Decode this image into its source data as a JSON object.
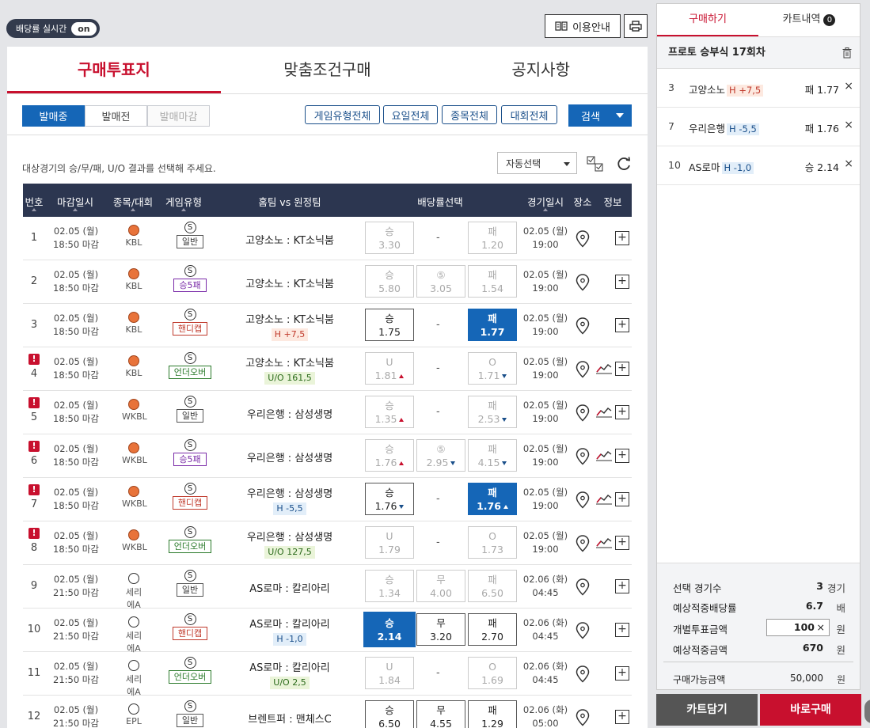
{
  "top": {
    "live_label": "배당률 실시간",
    "live_state": "on",
    "guide_label": "이용안내"
  },
  "tabs": [
    "구매투표지",
    "맞춤조건구매",
    "공지사항"
  ],
  "status_tabs": [
    "발매중",
    "발매전",
    "발매마감"
  ],
  "filters": [
    "게임유형전체",
    "요일전체",
    "종목전체",
    "대회전체"
  ],
  "search_label": "검색",
  "instruction": "대상경기의 승/무/패, U/O 결과를 선택해 주세요.",
  "auto_select": "자동선택",
  "columns": [
    "번호",
    "마감일시",
    "종목/대회",
    "게임유형",
    "홈팀 vs 원정팀",
    "배당률선택",
    "경기일시",
    "장소",
    "정보"
  ],
  "rows": [
    {
      "num": "1",
      "warn": false,
      "date": "02.05 (월)",
      "close": "18:50 마감",
      "league": "KBL",
      "ball": "bball",
      "gtype": "일반",
      "gclass": "t-gen",
      "match": "고양소노 : KT소닉붐",
      "sub": "",
      "subclass": "",
      "odds": [
        {
          "label": "승",
          "value": "3.30",
          "state": ""
        },
        null,
        {
          "label": "패",
          "value": "1.20",
          "state": ""
        }
      ],
      "gdate": "02.05 (월)",
      "gtime": "19:00",
      "chart": false
    },
    {
      "num": "2",
      "warn": false,
      "date": "02.05 (월)",
      "close": "18:50 마감",
      "league": "KBL",
      "ball": "bball",
      "gtype": "승5패",
      "gclass": "t-s5",
      "match": "고양소노 : KT소닉붐",
      "sub": "",
      "subclass": "",
      "odds": [
        {
          "label": "승",
          "value": "5.80",
          "state": ""
        },
        {
          "label": "⑤",
          "value": "3.05",
          "state": ""
        },
        {
          "label": "패",
          "value": "1.54",
          "state": ""
        }
      ],
      "gdate": "02.05 (월)",
      "gtime": "19:00",
      "chart": false
    },
    {
      "num": "3",
      "warn": false,
      "date": "02.05 (월)",
      "close": "18:50 마감",
      "league": "KBL",
      "ball": "bball",
      "gtype": "핸디캡",
      "gclass": "t-hc",
      "match": "고양소노 : KT소닉붐",
      "sub": "H +7,5",
      "subclass": "hp",
      "odds": [
        {
          "label": "승",
          "value": "1.75",
          "state": "act"
        },
        null,
        {
          "label": "패",
          "value": "1.77",
          "state": "sel"
        }
      ],
      "gdate": "02.05 (월)",
      "gtime": "19:00",
      "chart": false
    },
    {
      "num": "4",
      "warn": true,
      "date": "02.05 (월)",
      "close": "18:50 마감",
      "league": "KBL",
      "ball": "bball",
      "gtype": "언더오버",
      "gclass": "t-uo",
      "match": "고양소노 : KT소닉붐",
      "sub": "U/O 161,5",
      "subclass": "uo",
      "odds": [
        {
          "label": "U",
          "value": "1.81",
          "state": "",
          "trend": "up"
        },
        null,
        {
          "label": "O",
          "value": "1.71",
          "state": "",
          "trend": "dn"
        }
      ],
      "gdate": "02.05 (월)",
      "gtime": "19:00",
      "chart": true
    },
    {
      "num": "5",
      "warn": true,
      "date": "02.05 (월)",
      "close": "18:50 마감",
      "league": "WKBL",
      "ball": "bball",
      "gtype": "일반",
      "gclass": "t-gen",
      "match": "우리은행 : 삼성생명",
      "sub": "",
      "subclass": "",
      "odds": [
        {
          "label": "승",
          "value": "1.35",
          "state": "",
          "trend": "up"
        },
        null,
        {
          "label": "패",
          "value": "2.53",
          "state": "",
          "trend": "dn"
        }
      ],
      "gdate": "02.05 (월)",
      "gtime": "19:00",
      "chart": true
    },
    {
      "num": "6",
      "warn": true,
      "date": "02.05 (월)",
      "close": "18:50 마감",
      "league": "WKBL",
      "ball": "bball",
      "gtype": "승5패",
      "gclass": "t-s5",
      "match": "우리은행 : 삼성생명",
      "sub": "",
      "subclass": "",
      "odds": [
        {
          "label": "승",
          "value": "1.76",
          "state": "",
          "trend": "up"
        },
        {
          "label": "⑤",
          "value": "2.95",
          "state": "",
          "trend": "dn"
        },
        {
          "label": "패",
          "value": "4.15",
          "state": "",
          "trend": "dn"
        }
      ],
      "gdate": "02.05 (월)",
      "gtime": "19:00",
      "chart": true
    },
    {
      "num": "7",
      "warn": true,
      "date": "02.05 (월)",
      "close": "18:50 마감",
      "league": "WKBL",
      "ball": "bball",
      "gtype": "핸디캡",
      "gclass": "t-hc",
      "match": "우리은행 : 삼성생명",
      "sub": "H -5,5",
      "subclass": "hm",
      "odds": [
        {
          "label": "승",
          "value": "1.76",
          "state": "act",
          "trend": "dn"
        },
        null,
        {
          "label": "패",
          "value": "1.76",
          "state": "sel",
          "trend": "up"
        }
      ],
      "gdate": "02.05 (월)",
      "gtime": "19:00",
      "chart": true
    },
    {
      "num": "8",
      "warn": true,
      "date": "02.05 (월)",
      "close": "18:50 마감",
      "league": "WKBL",
      "ball": "bball",
      "gtype": "언더오버",
      "gclass": "t-uo",
      "match": "우리은행 : 삼성생명",
      "sub": "U/O 127,5",
      "subclass": "uo",
      "odds": [
        {
          "label": "U",
          "value": "1.79",
          "state": ""
        },
        null,
        {
          "label": "O",
          "value": "1.73",
          "state": ""
        }
      ],
      "gdate": "02.05 (월)",
      "gtime": "19:00",
      "chart": true
    },
    {
      "num": "9",
      "warn": false,
      "date": "02.05 (월)",
      "close": "21:50 마감",
      "league": "세리에A",
      "ball": "sball",
      "gtype": "일반",
      "gclass": "t-gen",
      "match": "AS로마 : 칼리아리",
      "sub": "",
      "subclass": "",
      "odds": [
        {
          "label": "승",
          "value": "1.34",
          "state": ""
        },
        {
          "label": "무",
          "value": "4.00",
          "state": ""
        },
        {
          "label": "패",
          "value": "6.50",
          "state": ""
        }
      ],
      "gdate": "02.06 (화)",
      "gtime": "04:45",
      "chart": false
    },
    {
      "num": "10",
      "warn": false,
      "date": "02.05 (월)",
      "close": "21:50 마감",
      "league": "세리에A",
      "ball": "sball",
      "gtype": "핸디캡",
      "gclass": "t-hc",
      "match": "AS로마 : 칼리아리",
      "sub": "H -1,0",
      "subclass": "hm",
      "odds": [
        {
          "label": "승",
          "value": "2.14",
          "state": "sel selb"
        },
        {
          "label": "무",
          "value": "3.20",
          "state": "act"
        },
        {
          "label": "패",
          "value": "2.70",
          "state": "act"
        }
      ],
      "gdate": "02.06 (화)",
      "gtime": "04:45",
      "chart": false
    },
    {
      "num": "11",
      "warn": false,
      "date": "02.05 (월)",
      "close": "21:50 마감",
      "league": "세리에A",
      "ball": "sball",
      "gtype": "언더오버",
      "gclass": "t-uo",
      "match": "AS로마 : 칼리아리",
      "sub": "U/O 2,5",
      "subclass": "uo",
      "odds": [
        {
          "label": "U",
          "value": "1.84",
          "state": ""
        },
        null,
        {
          "label": "O",
          "value": "1.69",
          "state": ""
        }
      ],
      "gdate": "02.06 (화)",
      "gtime": "04:45",
      "chart": false
    },
    {
      "num": "12",
      "warn": false,
      "date": "02.05 (월)",
      "close": "21:50 마감",
      "league": "EPL",
      "ball": "sball",
      "gtype": "일반",
      "gclass": "t-gen",
      "match": "브렌트퍼 : 맨체스C",
      "sub": "",
      "subclass": "",
      "odds": [
        {
          "label": "승",
          "value": "6.50",
          "state": "act"
        },
        {
          "label": "무",
          "value": "4.55",
          "state": "act"
        },
        {
          "label": "패",
          "value": "1.29",
          "state": "act"
        }
      ],
      "gdate": "02.06 (화)",
      "gtime": "05:00",
      "chart": false
    }
  ],
  "side": {
    "tabs": [
      "구매하기",
      "카트내역"
    ],
    "cart_count": "0",
    "title": "프로토 승부식 17회차",
    "picks": [
      {
        "num": "3",
        "team": "고양소노",
        "hc": "H +7,5",
        "hcclass": "hp",
        "odds": "패 1.77"
      },
      {
        "num": "7",
        "team": "우리은행",
        "hc": "H -5,5",
        "hcclass": "hm",
        "odds": "패 1.76"
      },
      {
        "num": "10",
        "team": "AS로마",
        "hc": "H -1,0",
        "hcclass": "hm",
        "odds": "승 2.14"
      }
    ],
    "summary": {
      "games_label": "선택 경기수",
      "games": "3",
      "games_unit": "경기",
      "odds_label": "예상적중배당률",
      "odds": "6.7",
      "odds_unit": "배",
      "bet_label": "개별투표금액",
      "bet": "100",
      "bet_unit": "원",
      "win_label": "예상적중금액",
      "win": "670",
      "win_unit": "원",
      "avail_label": "구매가능금액",
      "avail": "50,000",
      "avail_unit": "원"
    },
    "cart_button": "카트담기",
    "buy_button": "바로구매"
  }
}
